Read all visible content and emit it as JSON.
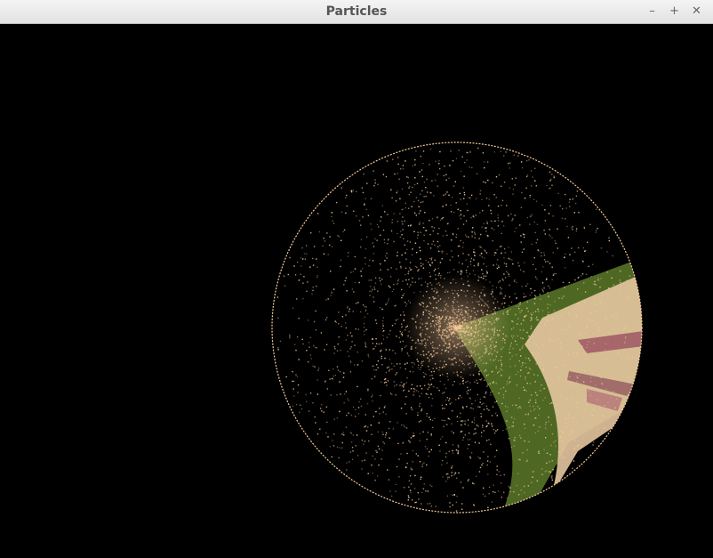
{
  "window": {
    "title": "Particles",
    "minimize_glyph": "–",
    "maximize_glyph": "+",
    "close_glyph": "✕"
  },
  "scene": {
    "background": "#000000",
    "particle_color": "#f5c99a",
    "leaf_color": "#5c7a2a",
    "skin_color": "#e6c6a0",
    "mauve_color": "#9a5060"
  }
}
